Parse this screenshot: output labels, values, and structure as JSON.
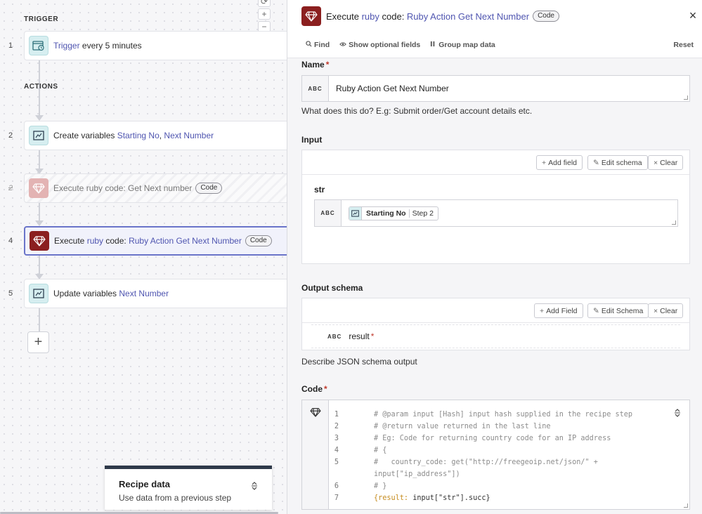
{
  "canvas": {
    "trigger_label": "TRIGGER",
    "actions_label": "ACTIONS",
    "steps": [
      {
        "num": "1",
        "prefix": "",
        "hl_a": "Trigger",
        "mid": " every 5 minutes",
        "hl_b": "",
        "suffix": "",
        "badge": ""
      },
      {
        "num": "2",
        "prefix": "Create variables ",
        "hl_a": "Starting No",
        "mid": ", ",
        "hl_b": "Next Number",
        "suffix": "",
        "badge": ""
      },
      {
        "num": "2",
        "prefix": "Execute ruby code: Get Next number",
        "hl_a": "",
        "mid": "",
        "hl_b": "",
        "suffix": "",
        "badge": "Code"
      },
      {
        "num": "4",
        "prefix": "Execute ",
        "hl_a": "ruby",
        "mid": " code: ",
        "hl_b": "Ruby Action Get Next Number",
        "suffix": "",
        "badge": "Code"
      },
      {
        "num": "5",
        "prefix": "Update variables ",
        "hl_a": "Next Number",
        "mid": "",
        "hl_b": "",
        "suffix": "",
        "badge": ""
      }
    ],
    "add_step_label": "+",
    "zoom_in": "+",
    "zoom_out": "−",
    "recipe_data": {
      "title": "Recipe data",
      "subtitle": "Use data from a previous step"
    }
  },
  "panel": {
    "header": {
      "prefix": "Execute ",
      "hl_a": "ruby",
      "mid": " code: ",
      "hl_b": "Ruby Action Get Next Number",
      "badge": "Code",
      "close": "×"
    },
    "toolbar": {
      "find": "Find",
      "show_optional": "Show optional fields",
      "group_map": "Group map data",
      "reset": "Reset"
    },
    "name_field": {
      "label": "Name",
      "abc": "ABC",
      "value": "Ruby Action Get Next Number",
      "hint": "What does this do? E.g: Submit order/Get account details etc."
    },
    "input_section": {
      "label": "Input",
      "add_field": "Add field",
      "edit_schema": "Edit schema",
      "clear": "Clear",
      "field_name": "str",
      "abc": "ABC",
      "pill_name": "Starting No",
      "pill_step": "Step 2"
    },
    "output_schema": {
      "label": "Output schema",
      "add_field": "Add Field",
      "edit_schema": "Edit Schema",
      "clear": "Clear",
      "abc": "ABC",
      "field_name": "result",
      "hint": "Describe JSON schema output"
    },
    "code": {
      "label": "Code",
      "lines": [
        {
          "n": "1",
          "text": "# @param input [Hash] input hash supplied in the recipe step"
        },
        {
          "n": "2",
          "text": "# @return value returned in the last line"
        },
        {
          "n": "3",
          "text": "# Eg: Code for returning country code for an IP address"
        },
        {
          "n": "4",
          "text": "# {"
        },
        {
          "n": "5",
          "text": "#   country_code: get(\"http://freegeoip.net/json/\" +"
        },
        {
          "n": "",
          "text": "input[\"ip_address\"])"
        },
        {
          "n": "6",
          "text": "# }"
        },
        {
          "n": "7",
          "text_key": "{result:",
          "text_rest": " input[\"str\"].succ}"
        }
      ]
    }
  }
}
